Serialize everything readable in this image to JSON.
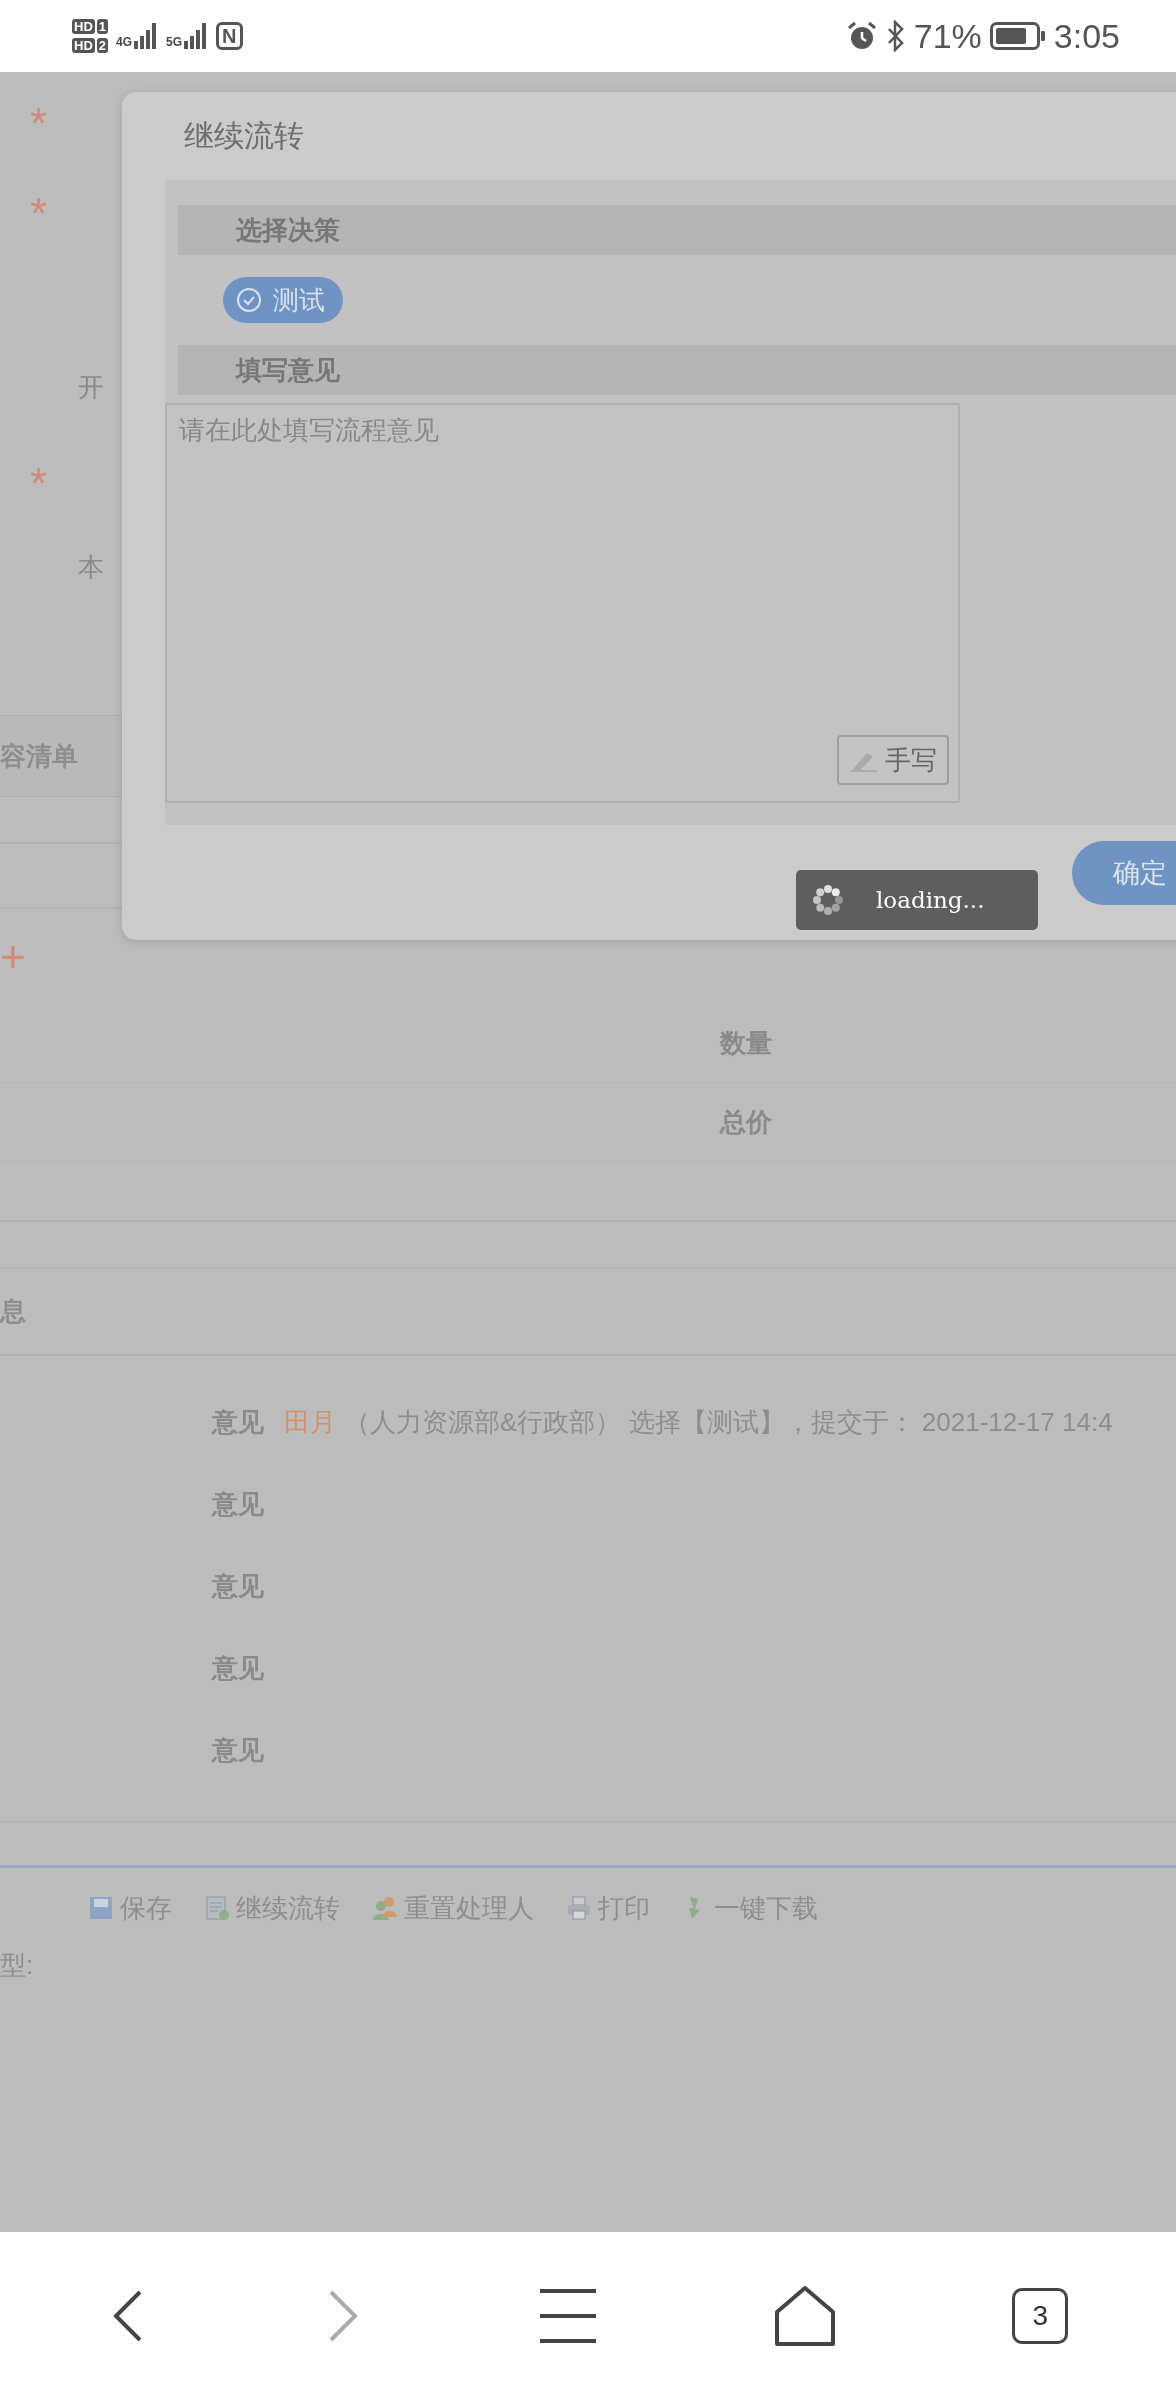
{
  "status_bar": {
    "sim_badges": [
      {
        "label": "HD",
        "slot": "1"
      },
      {
        "label": "HD",
        "slot": "2"
      }
    ],
    "networks": [
      "4G",
      "5G"
    ],
    "nfc": "N",
    "battery": "71%",
    "time": "3:05"
  },
  "form": {
    "rows": [
      {
        "kind": "required",
        "mark": "*"
      },
      {
        "kind": "required",
        "mark": "*"
      },
      {
        "kind": "blank"
      },
      {
        "kind": "label",
        "label": "开"
      },
      {
        "kind": "required",
        "mark": "*"
      },
      {
        "kind": "label",
        "label": "本"
      }
    ],
    "section_title": "容清单",
    "add_mark": "+",
    "table_labels": [
      "数量",
      "总价"
    ],
    "info_title": "息"
  },
  "opinions": [
    {
      "label": "意见",
      "author": "田月",
      "detail": "（人力资源部&行政部） 选择【测试】，提交于： 2021-12-17 14:4"
    },
    {
      "label": "意见"
    },
    {
      "label": "意见"
    },
    {
      "label": "意见"
    },
    {
      "label": "意见"
    }
  ],
  "toolbar": [
    {
      "kind": "save",
      "label": "保存"
    },
    {
      "kind": "flow",
      "label": "继续流转"
    },
    {
      "kind": "reset",
      "label": "重置处理人"
    },
    {
      "kind": "print",
      "label": "打印"
    },
    {
      "kind": "download",
      "label": "一键下载"
    }
  ],
  "type_label": "型:",
  "dialog": {
    "title": "继续流转",
    "decision_header": "选择决策",
    "decisions": [
      {
        "label": "测试",
        "selected": true
      }
    ],
    "opinion_header": "填写意见",
    "opinion": {
      "placeholder": "请在此处填写流程意见"
    },
    "handwrite_button": "手写",
    "confirm_button": "确定"
  },
  "loading": {
    "text": "loading..."
  },
  "nav": {
    "back": {
      "disabled": false
    },
    "forward": {
      "disabled": true
    },
    "tabs_count": "3"
  }
}
